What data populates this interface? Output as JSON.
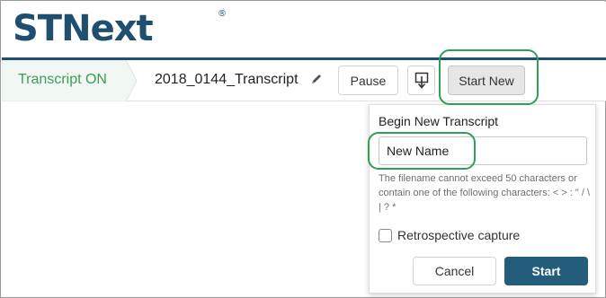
{
  "brand": {
    "logo_text": "STNext",
    "registered_mark": "®",
    "color": "#1f4f6e"
  },
  "toolbar": {
    "status_label": "Transcript ON",
    "status_color": "#3f9b57",
    "transcript_name": "2018_0144_Transcript",
    "pause_label": "Pause",
    "start_new_label": "Start New",
    "icons": [
      "pencil-icon",
      "download-icon"
    ]
  },
  "popup": {
    "title": "Begin New Transcript",
    "name_value": "New Name",
    "hint": "The filename cannot exceed 50 characters or contain one of the following characters: < > : \" / \\ | ? *",
    "retrospective_label": "Retrospective capture",
    "retrospective_checked": false,
    "cancel_label": "Cancel",
    "start_label": "Start",
    "accent_color": "#245d7c"
  },
  "highlight_color": "#2f9e57"
}
